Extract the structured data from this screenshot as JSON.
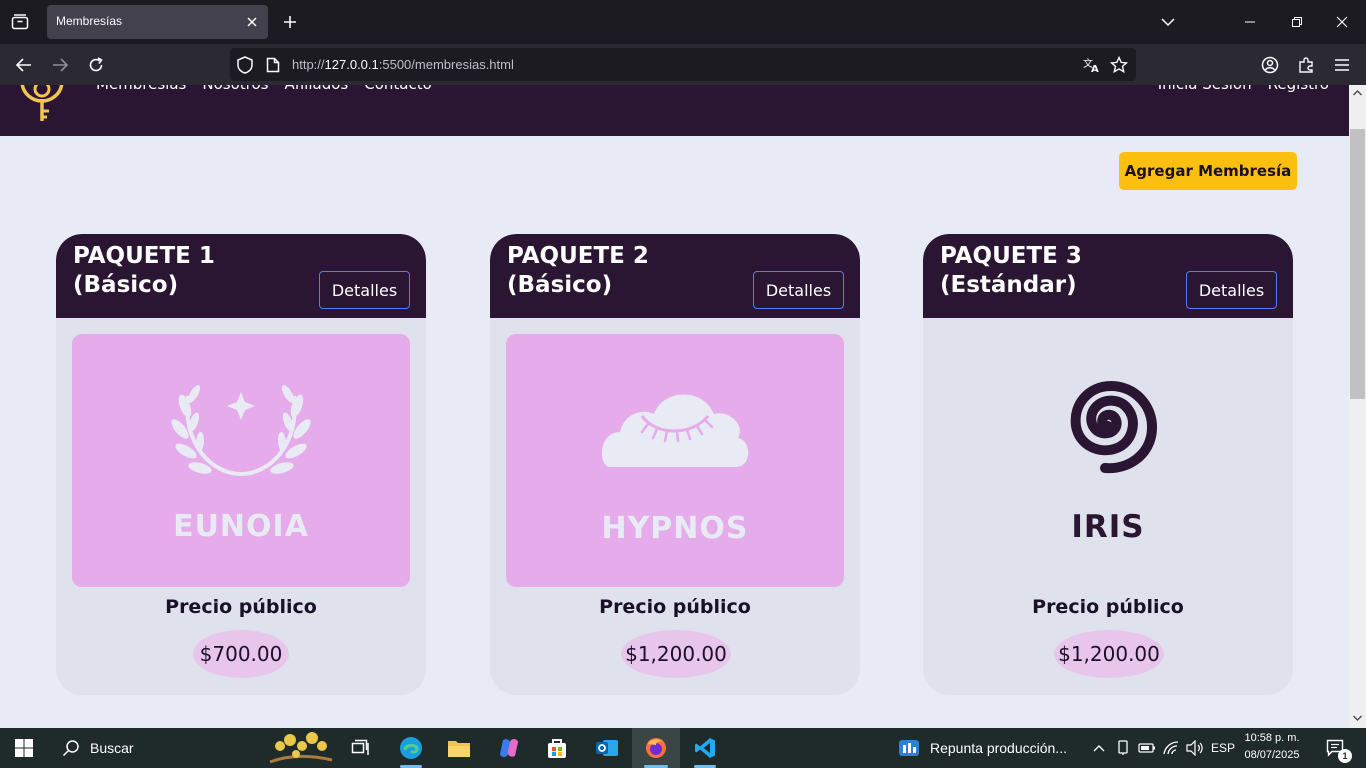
{
  "browser": {
    "tab_title": "Membresías",
    "url_prefix": "http://",
    "url_host": "127.0.0.1",
    "url_rest": ":5500/membresias.html"
  },
  "site": {
    "nav": [
      "Membresías",
      "Nosotros",
      "Afiliados",
      "Contacto"
    ],
    "auth": [
      "Inicia Sesión",
      "Registro"
    ],
    "add_button": "Agregar Membresía"
  },
  "cards": [
    {
      "title_line1": "PAQUETE 1",
      "title_line2": "(Básico)",
      "details": "Detalles",
      "brand": "EUNOIA",
      "price_label": "Precio público",
      "price": "$700.00"
    },
    {
      "title_line1": "PAQUETE 2",
      "title_line2": "(Básico)",
      "details": "Detalles",
      "brand": "HYPNOS",
      "price_label": "Precio público",
      "price": "$1,200.00"
    },
    {
      "title_line1": "PAQUETE 3",
      "title_line2": "(Estándar)",
      "details": "Detalles",
      "brand": "IRIS",
      "price_label": "Precio público",
      "price": "$1,200.00"
    }
  ],
  "taskbar": {
    "search": "Buscar",
    "notification_app": "Repunta producción...",
    "language": "ESP",
    "time": "10:58 p. m.",
    "date": "08/07/2025",
    "notification_count": "1"
  },
  "colors": {
    "header_bg": "#2a1532",
    "accent_yellow": "#fbbf0f",
    "card_pink": "#e5abea"
  }
}
